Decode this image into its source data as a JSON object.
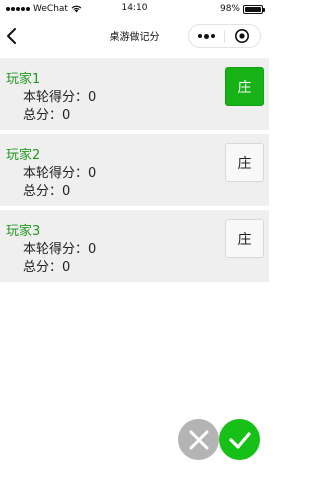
{
  "status_bar": {
    "carrier": "WeChat",
    "time": "14:10",
    "battery": "98%",
    "battery_level": 0.98
  },
  "nav": {
    "title": "桌游做记分"
  },
  "players": [
    {
      "name": "玩家1",
      "round_score": "本轮得分：0",
      "total_score": "总分：0",
      "dealer_label": "庄",
      "is_dealer": true
    },
    {
      "name": "玩家2",
      "round_score": "本轮得分：0",
      "total_score": "总分：0",
      "dealer_label": "庄",
      "is_dealer": false
    },
    {
      "name": "玩家3",
      "round_score": "本轮得分：0",
      "total_score": "总分：0",
      "dealer_label": "庄",
      "is_dealer": false
    }
  ],
  "icons": {
    "back": "chevron-left-icon",
    "more": "more-dots-icon",
    "close": "target-close-icon",
    "cancel": "x-icon",
    "confirm": "check-icon"
  },
  "colors": {
    "accent_green": "#16b216",
    "player_name_green": "#1f9a1f",
    "card_background": "#efefef",
    "cancel_gray": "#b4b4b4"
  }
}
